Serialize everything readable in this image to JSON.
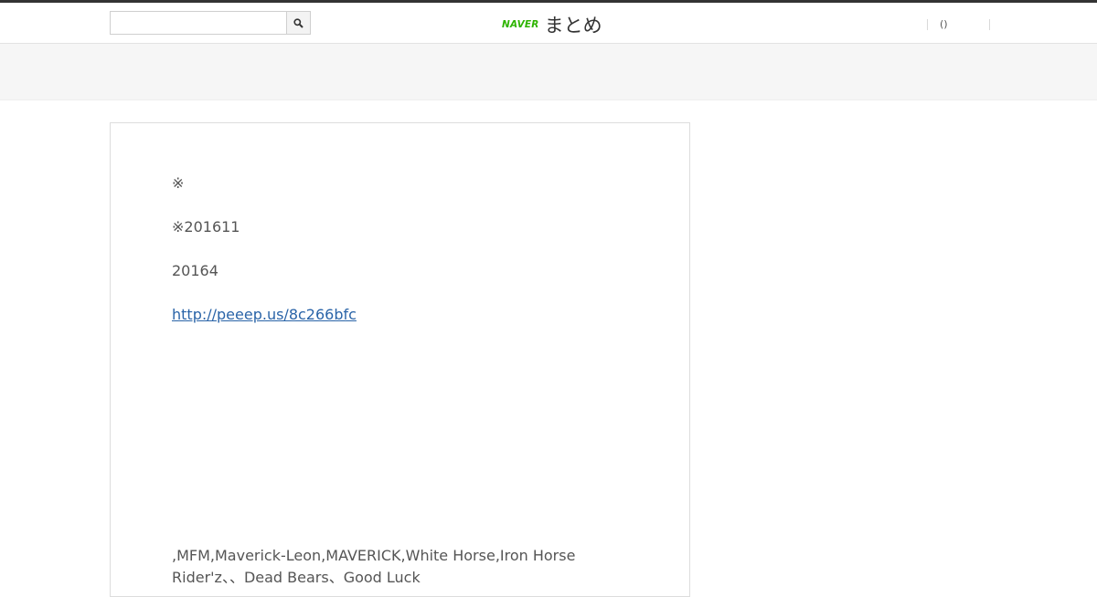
{
  "header": {
    "search": {
      "value": "",
      "placeholder": ""
    },
    "logo": {
      "brand": "NAVER",
      "product": "まとめ"
    },
    "user_nav": {
      "item_label": "()"
    }
  },
  "article": {
    "note_mark": "※",
    "note_date": "※201611",
    "date": "20164",
    "link": {
      "text": "http://peeep.us/8c266bfc",
      "href": "http://peeep.us/8c266bfc"
    },
    "paragraph": " ,MFM,Maverick-Leon,MAVERICK,White Horse,Iron Horse Rider'z、、Dead Bears、Good Luck"
  },
  "colors": {
    "top_border": "#333333",
    "brand_green": "#2db400",
    "link": "#2a64a8",
    "band": "#f6f6f6",
    "text": "#555555"
  }
}
